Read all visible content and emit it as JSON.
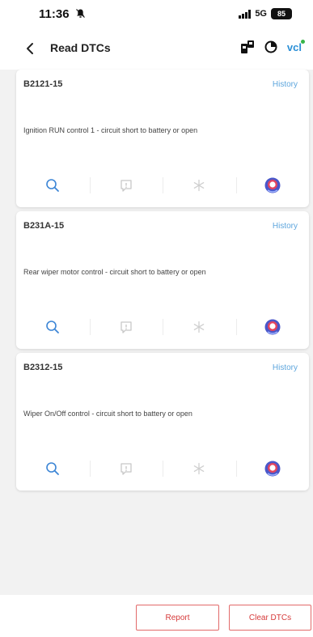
{
  "status_bar": {
    "time": "11:36",
    "network": "5G",
    "battery": "85"
  },
  "header": {
    "title": "Read DTCs",
    "vci_label": "vcl"
  },
  "dtc_items": [
    {
      "code": "B2121-15",
      "history_label": "History",
      "description": "Ignition RUN control 1 - circuit short to battery or open"
    },
    {
      "code": "B231A-15",
      "history_label": "History",
      "description": "Rear wiper motor control - circuit short to battery or open"
    },
    {
      "code": "B2312-15",
      "history_label": "History",
      "description": "Wiper On/Off control - circuit short to battery or open"
    }
  ],
  "footer": {
    "report_label": "Report",
    "clear_label": "Clear DTCs"
  },
  "colors": {
    "accent_blue": "#2a8fd6",
    "history_blue": "#5ea6dd",
    "button_red": "#d63a3a",
    "background": "#f2f2f2"
  },
  "icons": {
    "action_1": "search-icon",
    "action_2": "info-icon",
    "action_3": "freeze-frame-icon",
    "action_4": "assistant-icon"
  }
}
